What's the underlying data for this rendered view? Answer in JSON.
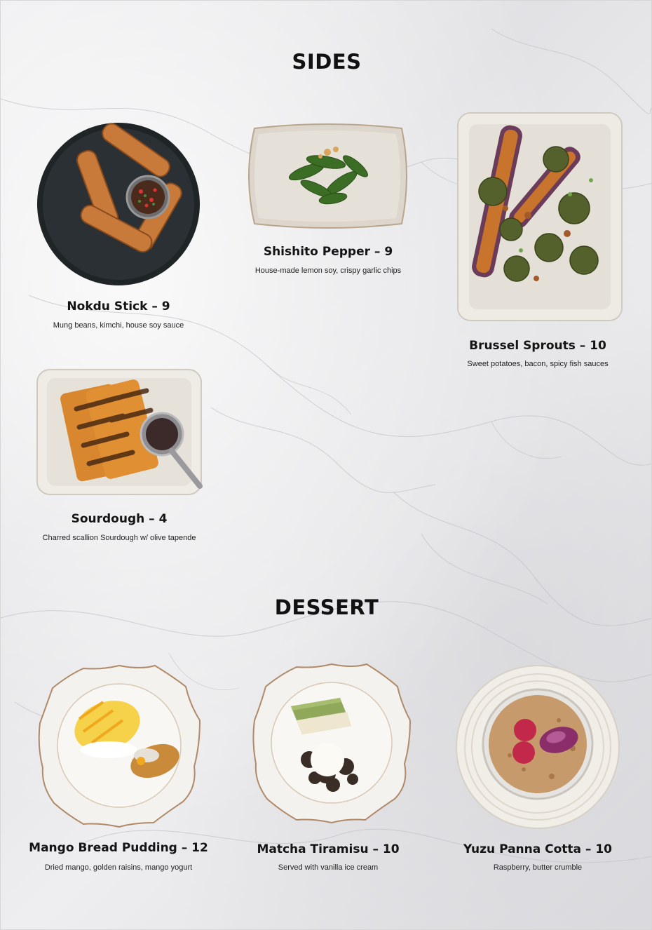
{
  "sections": {
    "sides": {
      "title": "SIDES",
      "items": [
        {
          "name": "Nokdu Stick – 9",
          "desc": "Mung beans, kimchi, house soy sauce"
        },
        {
          "name": "Shishito Pepper – 9",
          "desc": "House-made lemon soy, crispy garlic chips"
        },
        {
          "name": "Brussel Sprouts – 10",
          "desc": "Sweet potatoes, bacon, spicy fish sauces"
        },
        {
          "name": "Sourdough – 4",
          "desc": "Charred scallion Sourdough w/ olive tapende"
        }
      ]
    },
    "dessert": {
      "title": "DESSERT",
      "items": [
        {
          "name": "Mango Bread Pudding – 12",
          "desc": "Dried mango, golden raisins, mango yogurt"
        },
        {
          "name": "Matcha Tiramisu – 10",
          "desc": "Served with vanilla ice cream"
        },
        {
          "name": "Yuzu Panna Cotta – 10",
          "desc": "Raspberry, butter crumble"
        }
      ]
    }
  },
  "colors": {
    "background": "#e8e8ea",
    "text": "#111111"
  }
}
